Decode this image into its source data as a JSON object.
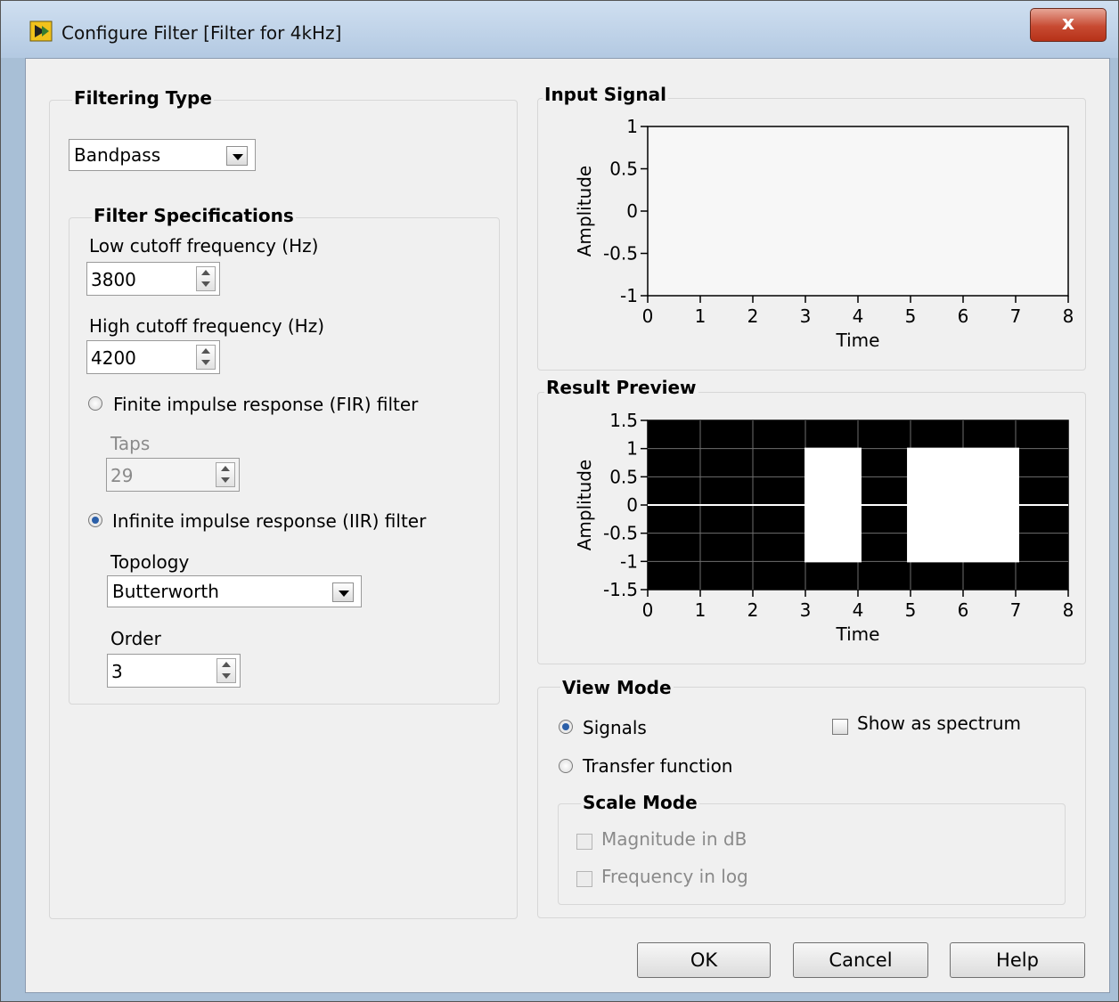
{
  "window": {
    "title": "Configure Filter [Filter for 4kHz]",
    "close_glyph": "x"
  },
  "filtering_type": {
    "label": "Filtering Type",
    "selected": "Bandpass"
  },
  "filter_specs": {
    "label": "Filter Specifications",
    "low_cutoff": {
      "label": "Low cutoff frequency (Hz)",
      "value": "3800"
    },
    "high_cutoff": {
      "label": "High cutoff frequency (Hz)",
      "value": "4200"
    },
    "fir": {
      "label": "Finite impulse response (FIR) filter",
      "selected": false
    },
    "taps": {
      "label": "Taps",
      "value": "29"
    },
    "iir": {
      "label": "Infinite impulse response (IIR) filter",
      "selected": true
    },
    "topology": {
      "label": "Topology",
      "selected": "Butterworth"
    },
    "order": {
      "label": "Order",
      "value": "3"
    }
  },
  "input_signal": {
    "label": "Input Signal"
  },
  "result_preview": {
    "label": "Result Preview"
  },
  "view_mode": {
    "label": "View Mode",
    "signals": {
      "label": "Signals",
      "selected": true
    },
    "transfer_function": {
      "label": "Transfer function",
      "selected": false
    },
    "show_as_spectrum": {
      "label": "Show as spectrum",
      "checked": false
    },
    "scale_mode": {
      "label": "Scale Mode",
      "magnitude_db": {
        "label": "Magnitude in dB",
        "checked": false
      },
      "frequency_log": {
        "label": "Frequency in log",
        "checked": false
      }
    }
  },
  "buttons": {
    "ok": "OK",
    "cancel": "Cancel",
    "help": "Help"
  },
  "chart_data": [
    {
      "type": "line",
      "xlabel": "Time",
      "ylabel": "Amplitude",
      "xlim": [
        0,
        8
      ],
      "ylim": [
        -1,
        1
      ],
      "xticks": [
        "0",
        "1",
        "2",
        "3",
        "4",
        "5",
        "6",
        "7",
        "8"
      ],
      "yticks": [
        "1",
        "0.5",
        "0",
        "-0.5",
        "-1"
      ],
      "background": "#f7f7f7",
      "series": []
    },
    {
      "type": "line",
      "xlabel": "Time",
      "ylabel": "Amplitude",
      "xlim": [
        0,
        8
      ],
      "ylim": [
        -1.5,
        1.5
      ],
      "xticks": [
        "0",
        "1",
        "2",
        "3",
        "4",
        "5",
        "6",
        "7",
        "8"
      ],
      "yticks": [
        "1.5",
        "1",
        "0.5",
        "0",
        "-0.5",
        "-1",
        "-1.5"
      ],
      "grid": true,
      "background": "#000000",
      "trace_color": "#ffffff",
      "series": [
        {
          "x": [
            0,
            3,
            3,
            4.05,
            4.05,
            4.95,
            4.95,
            7.05,
            7.05,
            8
          ],
          "y": [
            0,
            0,
            1,
            1,
            0,
            0,
            1,
            1,
            0,
            0
          ],
          "y_lower": [
            0,
            0,
            -1,
            -1,
            0,
            0,
            -1,
            -1,
            0,
            0
          ]
        }
      ]
    }
  ]
}
